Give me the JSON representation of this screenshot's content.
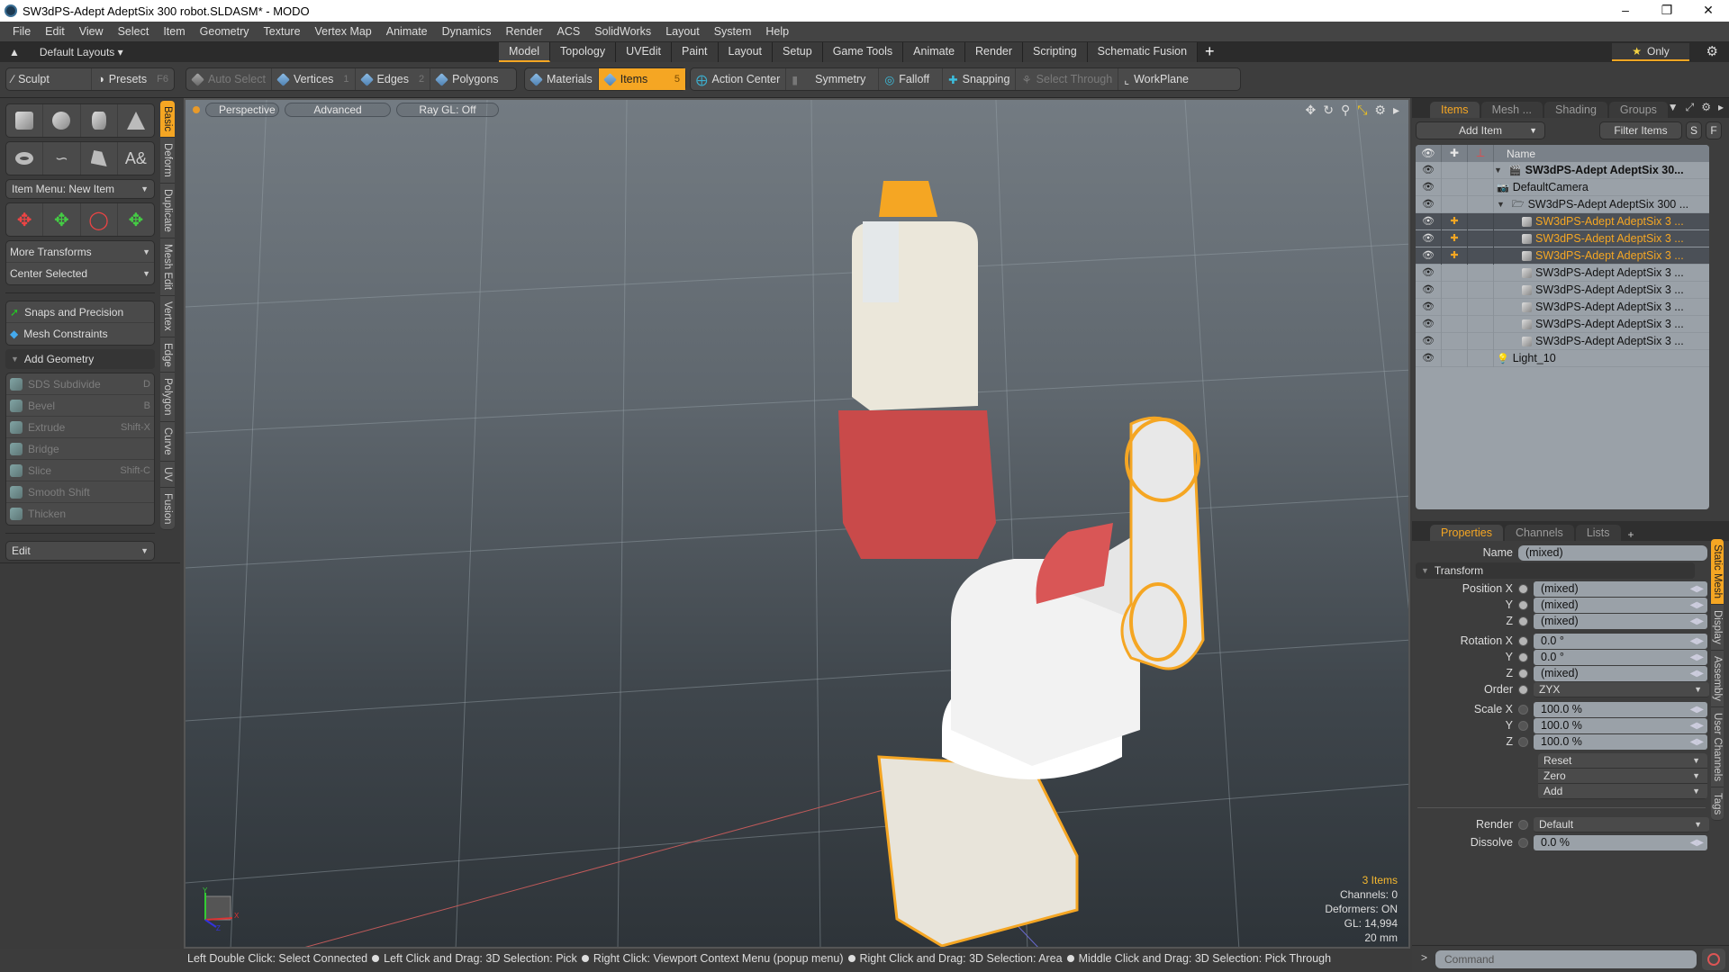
{
  "window": {
    "title": "SW3dPS-Adept AdeptSix 300 robot.SLDASM* - MODO",
    "controls": [
      "minimize",
      "restore",
      "close"
    ]
  },
  "menubar": [
    "File",
    "Edit",
    "View",
    "Select",
    "Item",
    "Geometry",
    "Texture",
    "Vertex Map",
    "Animate",
    "Dynamics",
    "Render",
    "ACS",
    "SolidWorks",
    "Layout",
    "System",
    "Help"
  ],
  "layoutbar": {
    "layouts_label": "Default Layouts ▾",
    "tabs": [
      "Model",
      "Topology",
      "UVEdit",
      "Paint",
      "Layout",
      "Setup",
      "Game Tools",
      "Animate",
      "Render",
      "Scripting",
      "Schematic Fusion"
    ],
    "active_tab": "Model",
    "add_tab": "+",
    "only_label": "Only"
  },
  "toolbar": {
    "sculpt": "Sculpt",
    "presets": "Presets",
    "presets_key": "F6",
    "auto_select": "Auto Select",
    "vertices": "Vertices",
    "vertices_key": "1",
    "edges": "Edges",
    "edges_key": "2",
    "polygons": "Polygons",
    "materials": "Materials",
    "items": "Items",
    "items_key": "5",
    "action_center": "Action Center",
    "symmetry": "Symmetry",
    "falloff": "Falloff",
    "snapping": "Snapping",
    "select_through": "Select Through",
    "workplane": "WorkPlane"
  },
  "leftpanel": {
    "item_menu": "Item Menu: New Item",
    "more_transforms": "More Transforms",
    "center_selected": "Center Selected",
    "snaps": "Snaps and Precision",
    "mesh_constraints": "Mesh Constraints",
    "add_geometry": "Add Geometry",
    "geometry_tools": [
      {
        "label": "SDS Subdivide",
        "key": "D"
      },
      {
        "label": "Bevel",
        "key": "B"
      },
      {
        "label": "Extrude",
        "key": "Shift-X"
      },
      {
        "label": "Bridge",
        "key": ""
      },
      {
        "label": "Slice",
        "key": "Shift-C"
      },
      {
        "label": "Smooth Shift",
        "key": ""
      },
      {
        "label": "Thicken",
        "key": ""
      }
    ],
    "edit": "Edit",
    "vtabs": [
      "Basic",
      "Deform",
      "Duplicate",
      "Mesh Edit",
      "Vertex",
      "Edge",
      "Polygon",
      "Curve",
      "UV",
      "Fusion"
    ],
    "active_vtab": "Basic"
  },
  "viewport": {
    "view": "Perspective",
    "shading": "Advanced",
    "raygl": "Ray GL: Off",
    "info": {
      "selection": "3 Items",
      "channels": "Channels: 0",
      "deformers": "Deformers: ON",
      "gl": "GL: 14,994",
      "scale": "20 mm"
    },
    "axis_labels": {
      "x": "X",
      "y": "Y",
      "z": "Z"
    },
    "colors": {
      "selection": "#f5a623",
      "red_part": "#c94a4a",
      "white_part": "#f0efe8"
    }
  },
  "statusbar": [
    "Left Double Click: Select Connected",
    "Left Click and Drag: 3D Selection: Pick",
    "Right Click: Viewport Context Menu (popup menu)",
    "Right Click and Drag: 3D Selection: Area",
    "Middle Click and Drag: 3D Selection: Pick Through"
  ],
  "itemspanel": {
    "tabs": [
      "Items",
      "Mesh ...",
      "Shading",
      "Groups"
    ],
    "active_tab": "Items",
    "add_item": "Add Item",
    "filter_items": "Filter Items",
    "s_btn": "S",
    "f_btn": "F",
    "col_name": "Name",
    "rows": [
      {
        "label": "SW3dPS-Adept AdeptSix 30...",
        "type": "scene",
        "selected": false,
        "bold": true
      },
      {
        "label": "DefaultCamera",
        "type": "camera",
        "selected": false,
        "bold": false
      },
      {
        "label": "SW3dPS-Adept AdeptSix 300 ...",
        "type": "folder",
        "selected": false,
        "bold": false
      },
      {
        "label": "SW3dPS-Adept AdeptSix 3 ...",
        "type": "mesh",
        "selected": true,
        "bold": false
      },
      {
        "label": "SW3dPS-Adept AdeptSix 3 ...",
        "type": "mesh",
        "selected": true,
        "bold": false
      },
      {
        "label": "SW3dPS-Adept AdeptSix 3 ...",
        "type": "mesh",
        "selected": true,
        "bold": false
      },
      {
        "label": "SW3dPS-Adept AdeptSix 3 ...",
        "type": "mesh",
        "selected": false,
        "bold": false
      },
      {
        "label": "SW3dPS-Adept AdeptSix 3 ...",
        "type": "mesh",
        "selected": false,
        "bold": false
      },
      {
        "label": "SW3dPS-Adept AdeptSix 3 ...",
        "type": "mesh",
        "selected": false,
        "bold": false
      },
      {
        "label": "SW3dPS-Adept AdeptSix 3 ...",
        "type": "mesh",
        "selected": false,
        "bold": false
      },
      {
        "label": "SW3dPS-Adept AdeptSix 3 ...",
        "type": "mesh",
        "selected": false,
        "bold": false
      },
      {
        "label": "Light_10",
        "type": "light",
        "selected": false,
        "bold": false
      }
    ]
  },
  "properties": {
    "tabs": [
      "Properties",
      "Channels",
      "Lists"
    ],
    "active_tab": "Properties",
    "name_label": "Name",
    "name_value": "(mixed)",
    "transform_label": "Transform",
    "position": {
      "label": "Position X",
      "x": "(mixed)",
      "y": "(mixed)",
      "z": "(mixed)"
    },
    "rotation": {
      "label": "Rotation X",
      "x": "0.0 °",
      "y": "0.0 °",
      "z": "(mixed)"
    },
    "order": {
      "label": "Order",
      "value": "ZYX"
    },
    "scale": {
      "label": "Scale X",
      "x": "100.0 %",
      "y": "100.0 %",
      "z": "100.0 %"
    },
    "axis_y": "Y",
    "axis_z": "Z",
    "reset": "Reset",
    "zero": "Zero",
    "add": "Add",
    "render": {
      "label": "Render",
      "value": "Default"
    },
    "dissolve": {
      "label": "Dissolve",
      "value": "0.0 %"
    },
    "vtabs": [
      "Static Mesh",
      "Display",
      "Assembly",
      "User Channels",
      "Tags"
    ],
    "active_vtab": "Static Mesh"
  },
  "command": {
    "prompt": ">",
    "placeholder": "Command"
  }
}
